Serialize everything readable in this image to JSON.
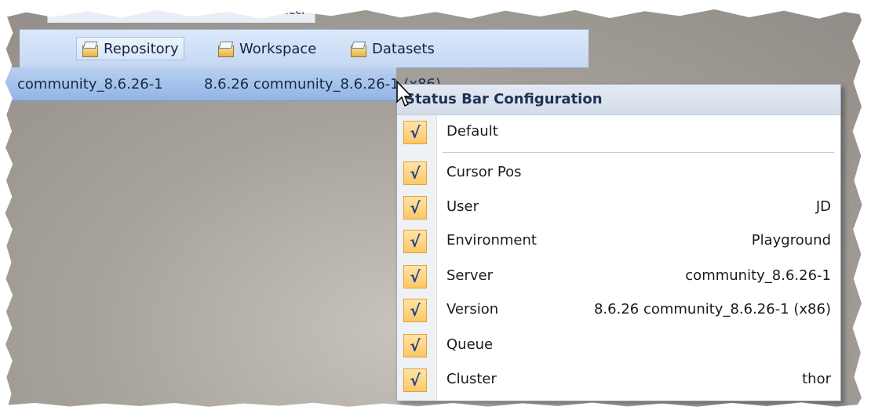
{
  "file_tab": {
    "label": "File.ecl"
  },
  "toolbar": {
    "buttons": [
      {
        "label": "Repository",
        "icon": "repository-icon"
      },
      {
        "label": "Workspace",
        "icon": "workspace-icon"
      },
      {
        "label": "Datasets",
        "icon": "datasets-icon"
      }
    ]
  },
  "status_bar": {
    "server": "community_8.6.26-1",
    "version": "8.6.26 community_8.6.26-1 (x86)"
  },
  "menu": {
    "title": "Status Bar Configuration",
    "check_glyph": "√",
    "items": [
      {
        "label": "Default",
        "value": "",
        "checked": true
      },
      {
        "label": "Cursor Pos",
        "value": "",
        "checked": true
      },
      {
        "label": "User",
        "value": "JD",
        "checked": true
      },
      {
        "label": "Environment",
        "value": "Playground",
        "checked": true
      },
      {
        "label": "Server",
        "value": "community_8.6.26-1",
        "checked": true
      },
      {
        "label": "Version",
        "value": "8.6.26 community_8.6.26-1 (x86)",
        "checked": true
      },
      {
        "label": "Queue",
        "value": "",
        "checked": true
      },
      {
        "label": "Cluster",
        "value": "thor",
        "checked": true
      }
    ]
  },
  "colors": {
    "toolbar_bg": "#c4d8f3",
    "status_bar_bg": "#93b4e4",
    "check_bg": "#fcc867",
    "check_mark": "#1f3b8c"
  }
}
